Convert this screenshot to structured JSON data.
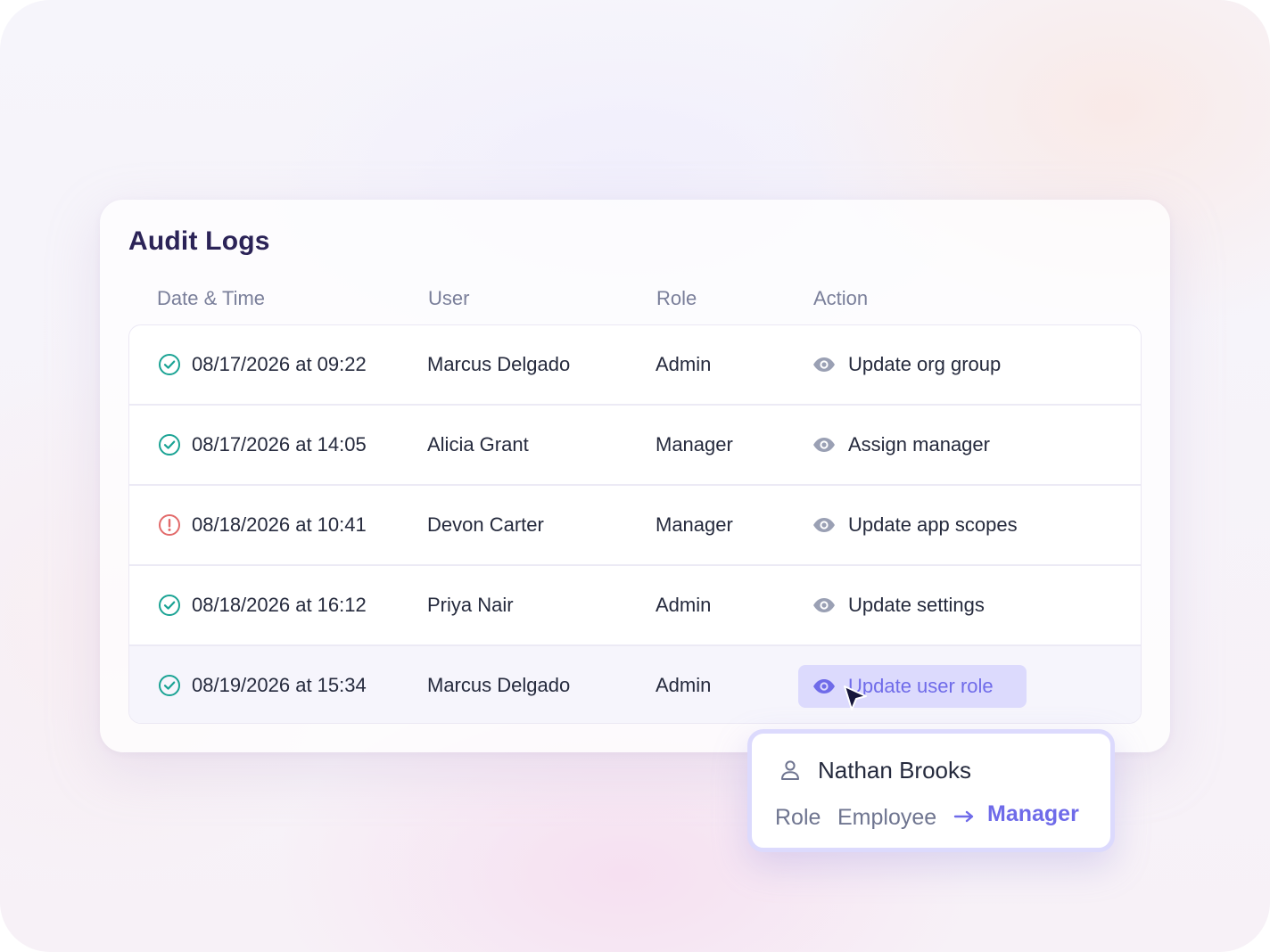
{
  "audit_logs": {
    "title": "Audit Logs",
    "columns": {
      "date_time": "Date & Time",
      "user": "User",
      "role": "Role",
      "action": "Action"
    },
    "rows": [
      {
        "status": "success",
        "date_time": "08/17/2026 at 09:22",
        "user": "Marcus Delgado",
        "role": "Admin",
        "action": "Update org group"
      },
      {
        "status": "success",
        "date_time": "08/17/2026 at 14:05",
        "user": "Alicia Grant",
        "role": "Manager",
        "action": "Assign manager"
      },
      {
        "status": "error",
        "date_time": "08/18/2026 at 10:41",
        "user": "Devon Carter",
        "role": "Manager",
        "action": "Update app scopes"
      },
      {
        "status": "success",
        "date_time": "08/18/2026 at 16:12",
        "user": "Priya Nair",
        "role": "Admin",
        "action": "Update settings"
      },
      {
        "status": "success",
        "date_time": "08/19/2026 at 15:34",
        "user": "Marcus Delgado",
        "role": "Admin",
        "action": "Update user role",
        "highlighted": true
      }
    ]
  },
  "popover": {
    "person_name": "Nathan Brooks",
    "role_label": "Role",
    "from_role": "Employee",
    "to_role": "Manager"
  },
  "icons": {
    "success": "check-circle-icon",
    "error": "alert-circle-icon",
    "view": "eye-icon",
    "person": "person-icon",
    "arrow": "arrow-right-icon",
    "cursor": "cursor-icon"
  },
  "colors": {
    "success": "#1aa394",
    "error": "#e26a6a",
    "accent": "#6f6be9",
    "eye": "#9aa0b4"
  }
}
